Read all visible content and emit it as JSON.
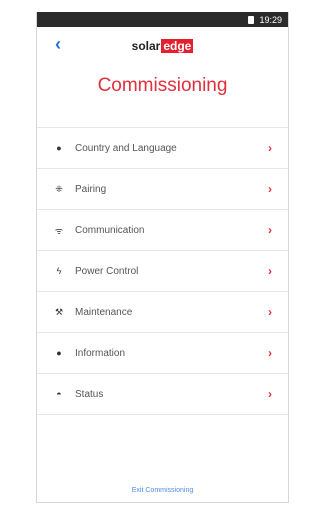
{
  "status_bar": {
    "time": "19:29"
  },
  "header": {
    "back_symbol": "‹",
    "logo_prefix": "solar",
    "logo_suffix": "edge"
  },
  "page_title": "Commissioning",
  "menu": [
    {
      "label": "Country and Language",
      "icon": "globe-icon"
    },
    {
      "label": "Pairing",
      "icon": "pairing-icon"
    },
    {
      "label": "Communication",
      "icon": "wifi-icon"
    },
    {
      "label": "Power Control",
      "icon": "lightning-icon"
    },
    {
      "label": "Maintenance",
      "icon": "wrench-icon"
    },
    {
      "label": "Information",
      "icon": "info-icon"
    },
    {
      "label": "Status",
      "icon": "gauge-icon"
    }
  ],
  "footer": {
    "exit_label": "Exit Commissioning"
  },
  "colors": {
    "accent_red": "#e0303c",
    "link_blue": "#1a73d9"
  }
}
